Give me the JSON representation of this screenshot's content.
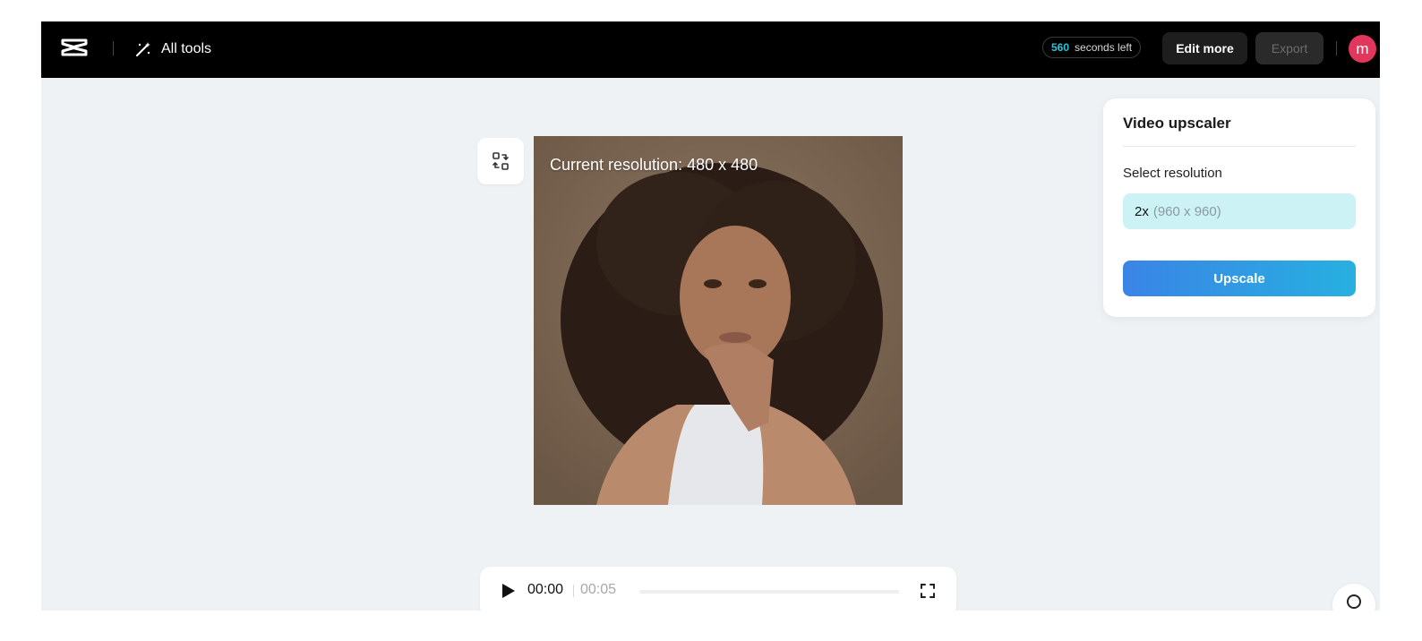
{
  "topbar": {
    "logo_icon": "capcut-logo-icon",
    "all_tools_icon": "magic-wand-icon",
    "all_tools_label": "All tools",
    "seconds_value": "560",
    "seconds_suffix": "seconds left",
    "edit_more_label": "Edit more",
    "export_label": "Export",
    "avatar_initial": "m",
    "colors": {
      "background": "#000000",
      "seconds_accent": "#26c6d9",
      "avatar": "#e3365d"
    }
  },
  "canvas": {
    "compare_icon": "swap-compare-icon",
    "resolution_label": "Current resolution: 480 x 480"
  },
  "upscaler_panel": {
    "title": "Video upscaler",
    "select_label": "Select resolution",
    "selected_multiplier": "2x",
    "selected_dimensions": "(960 x 960)",
    "upscale_label": "Upscale",
    "colors": {
      "selected_bg": "#cdf2f5",
      "button_gradient_start": "#3a84e6",
      "button_gradient_end": "#27b0e0"
    }
  },
  "player": {
    "play_icon": "play-icon",
    "current_time": "00:00",
    "duration": "00:05",
    "progress": 0,
    "fullscreen_icon": "fullscreen-icon"
  },
  "help": {
    "icon": "search-help-icon"
  }
}
